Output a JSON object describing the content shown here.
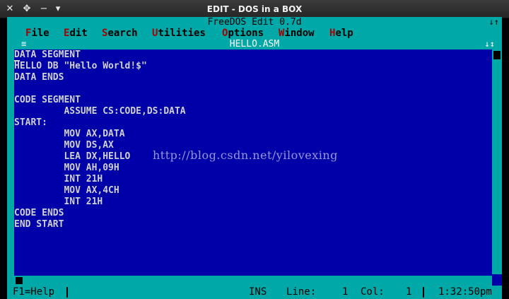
{
  "window": {
    "title": "EDIT - DOS in a BOX",
    "buttons": {
      "close": "✕",
      "expand": "✥",
      "minimize": "−",
      "menu": "▾"
    }
  },
  "app": {
    "title": "FreeDOS Edit 0.7d",
    "title_right": "↓↑",
    "menu": [
      {
        "label_hot": "F",
        "label_rest": "ile"
      },
      {
        "label_hot": "E",
        "label_rest": "dit"
      },
      {
        "label_hot": "S",
        "label_rest": "earch"
      },
      {
        "label_hot": "U",
        "label_rest": "tilities"
      },
      {
        "label_hot": "O",
        "label_rest": "ptions"
      },
      {
        "label_hot": "W",
        "label_rest": "indow"
      },
      {
        "label_hot": "H",
        "label_rest": "elp"
      }
    ]
  },
  "document": {
    "title": "HELLO.ASM",
    "left_icon": "≡",
    "right_icon": "↓↕",
    "lines": [
      "DATA SEGMENT",
      "HELLO DB \"Hello World!$\"",
      "DATA ENDS",
      "",
      "CODE SEGMENT",
      "         ASSUME CS:CODE,DS:DATA",
      "START:",
      "         MOV AX,DATA",
      "         MOV DS,AX",
      "         LEA DX,HELLO",
      "         MOV AH,09H",
      "         INT 21H",
      "         MOV AX,4CH",
      "         INT 21H",
      "CODE ENDS",
      "END START"
    ]
  },
  "status": {
    "help": "F1=Help",
    "mode": "INS",
    "line_label": "Line:",
    "line_value": "1",
    "col_label": "Col:",
    "col_value": "1",
    "time": "1:32:50pm"
  },
  "watermark": "http://blog.csdn.net/yilovexing",
  "colors": {
    "editor_bg": "#0000a8",
    "chrome": "#00a8a8",
    "text": "#d0d0d0",
    "hotkey": "#a80000"
  }
}
